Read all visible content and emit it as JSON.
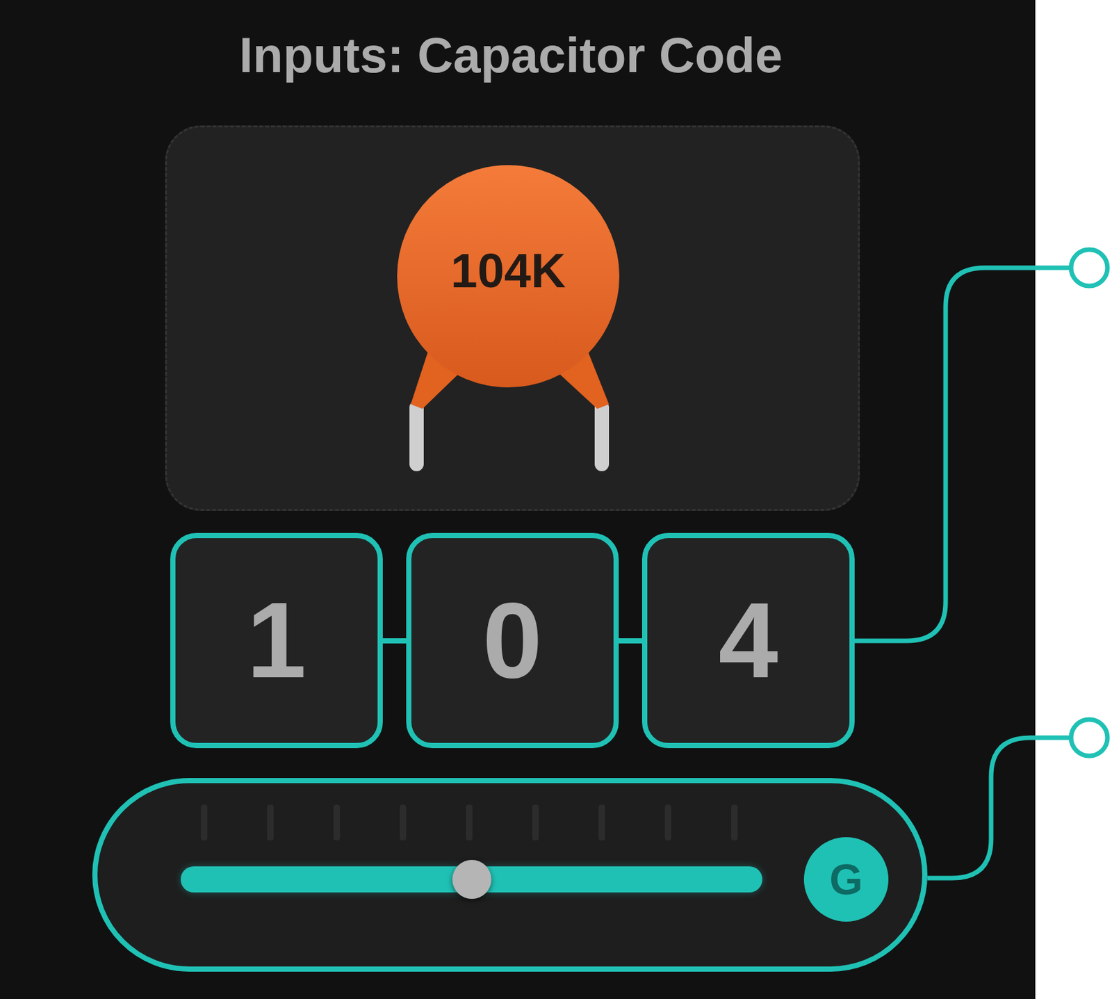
{
  "title": "Inputs: Capacitor Code",
  "capacitor": {
    "code": "104K"
  },
  "digits": [
    "1",
    "0",
    "4"
  ],
  "slider": {
    "level": 0.5,
    "badge": "G"
  }
}
